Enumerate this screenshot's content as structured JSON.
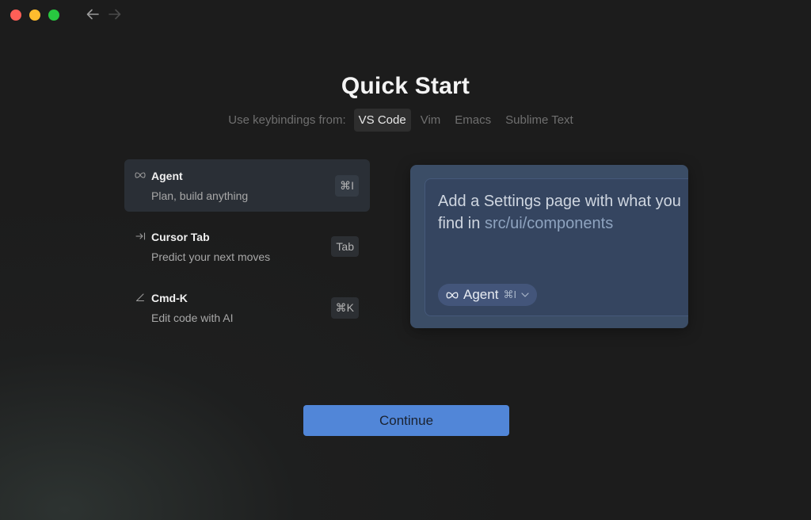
{
  "page": {
    "title": "Quick Start"
  },
  "keybindings": {
    "label": "Use keybindings from:",
    "options": [
      "VS Code",
      "Vim",
      "Emacs",
      "Sublime Text"
    ],
    "selected": "VS Code"
  },
  "features": [
    {
      "icon": "infinity-icon",
      "title": "Agent",
      "description": "Plan, build anything",
      "shortcut": "⌘I",
      "active": true
    },
    {
      "icon": "tab-arrow-icon",
      "title": "Cursor Tab",
      "description": "Predict your next moves",
      "shortcut": "Tab",
      "active": false
    },
    {
      "icon": "pencil-icon",
      "title": "Cmd-K",
      "description": "Edit code with AI",
      "shortcut": "⌘K",
      "active": false
    }
  ],
  "preview": {
    "text_before": "Add a Settings page with what you find in ",
    "text_path": "src/ui/components",
    "mode_label": "Agent",
    "mode_shortcut": "⌘I"
  },
  "actions": {
    "continue_label": "Continue"
  },
  "colors": {
    "accent": "#5186d8",
    "background": "#1c1c1c",
    "preview_bg": "#3b4d66"
  }
}
